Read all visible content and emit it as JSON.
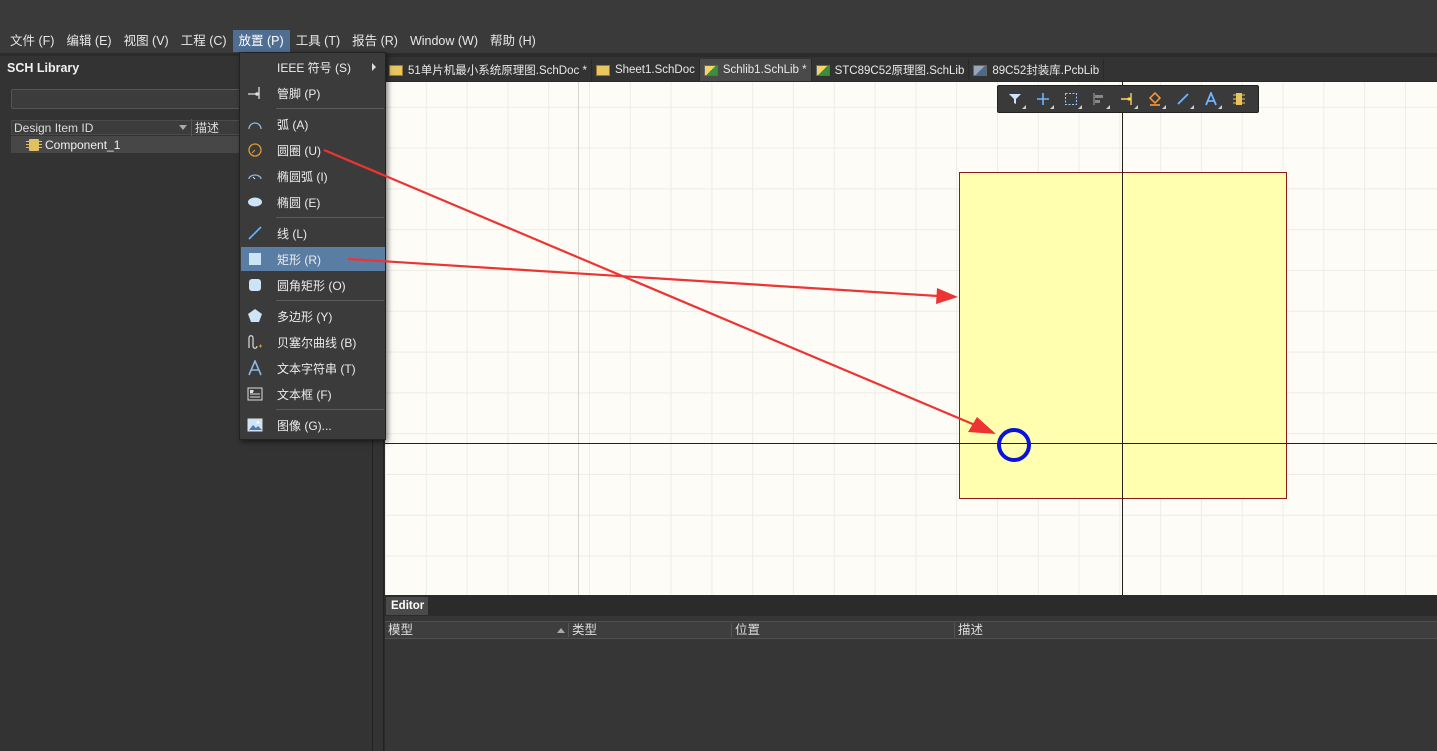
{
  "menubar": {
    "items": [
      "文件 (F)",
      "编辑 (E)",
      "视图 (V)",
      "工程 (C)",
      "放置 (P)",
      "工具 (T)",
      "报告 (R)",
      "Window (W)",
      "帮助 (H)"
    ],
    "active_index": 4
  },
  "left_panel": {
    "title": "SCH Library",
    "search_placeholder": "",
    "columns": [
      "Design Item ID",
      "描述"
    ],
    "rows": [
      {
        "id": "Component_1",
        "icon": "component-icon"
      }
    ]
  },
  "tabs": [
    {
      "label": "51单片机最小系统原理图.SchDoc *",
      "icon": "schdoc-icon",
      "active": false
    },
    {
      "label": "Sheet1.SchDoc",
      "icon": "schdoc-icon",
      "active": false
    },
    {
      "label": "Schlib1.SchLib *",
      "icon": "schlib-icon",
      "active": true
    },
    {
      "label": "STC89C52原理图.SchLib",
      "icon": "schlib-icon",
      "active": false
    },
    {
      "label": "89C52封装库.PcbLib",
      "icon": "pcblib-icon",
      "active": false
    }
  ],
  "place_menu": {
    "items": [
      {
        "label": "IEEE 符号 (S)",
        "icon": "",
        "submenu": true
      },
      {
        "label": "管脚 (P)",
        "icon": "pin-icon"
      },
      {
        "label": "弧 (A)",
        "icon": "arc-icon"
      },
      {
        "label": "圆圈 (U)",
        "icon": "circle-icon"
      },
      {
        "label": "椭圆弧 (I)",
        "icon": "elliptical-arc-icon"
      },
      {
        "label": "椭圆 (E)",
        "icon": "ellipse-icon"
      },
      {
        "label": "线 (L)",
        "icon": "line-icon"
      },
      {
        "label": "矩形 (R)",
        "icon": "rectangle-icon",
        "highlighted": true
      },
      {
        "label": "圆角矩形 (O)",
        "icon": "round-rectangle-icon"
      },
      {
        "label": "多边形 (Y)",
        "icon": "polygon-icon"
      },
      {
        "label": "贝塞尔曲线 (B)",
        "icon": "bezier-icon"
      },
      {
        "label": "文本字符串 (T)",
        "icon": "text-string-icon"
      },
      {
        "label": "文本框 (F)",
        "icon": "text-frame-icon"
      },
      {
        "label": "图像 (G)...",
        "icon": "image-icon"
      }
    ]
  },
  "canvas": {
    "shape_fill": "#ffffaf",
    "shape_border": "#8b1a1a",
    "cursor_color": "#0a14d8",
    "arrow_color": "#ee3333"
  },
  "float_toolbar": [
    "filter-icon",
    "crosshair-icon",
    "select-rect-icon",
    "align-icon",
    "pin-icon",
    "fill-icon",
    "line-icon",
    "text-icon",
    "component-icon"
  ],
  "editor": {
    "tab_label": "Editor",
    "columns": [
      "模型",
      "类型",
      "位置",
      "描述"
    ]
  }
}
